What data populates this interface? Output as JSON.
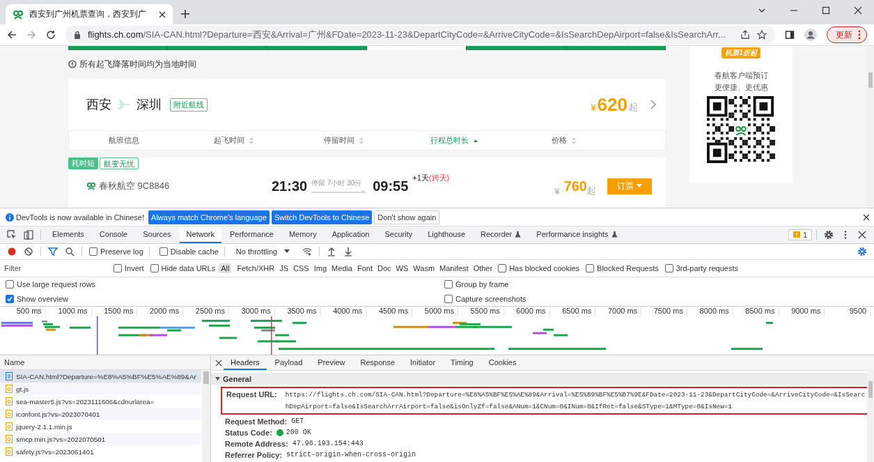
{
  "browser": {
    "tab_title": "西安到广州机票查询，西安到广",
    "url_host": "flights.ch.com",
    "url_path": "/SIA-CAN.html?Departure=西安&Arrival=广州&FDate=2023-11-23&DepartCityCode=&ArriveCityCode=&IsSearchDepAirport=false&IsSearchArr...",
    "update_button": "更新"
  },
  "page": {
    "notice": "所有起飞降落时间均为当地时间",
    "route": {
      "from": "西安",
      "to": "深圳",
      "tag": "附近航线",
      "currency": "¥",
      "price": "620",
      "suffix": "起"
    },
    "sort_columns": [
      {
        "label": "航班信息",
        "sortable": false,
        "selected": false
      },
      {
        "label": "起飞时间",
        "sortable": true,
        "selected": false
      },
      {
        "label": "停留时间",
        "sortable": true,
        "selected": false
      },
      {
        "label": "行程总时长",
        "sortable": true,
        "selected": true
      },
      {
        "label": "价格",
        "sortable": true,
        "selected": false
      }
    ],
    "flight": {
      "tags": [
        {
          "label": "耗时短",
          "kind": "filled"
        },
        {
          "label": "航变无忧",
          "kind": "outline"
        }
      ],
      "airline": "春秋航空 9C8846",
      "depart": "21:30",
      "stop": "停留 7小时 30分",
      "arrive": "09:55",
      "next_day": "+1天",
      "next_day_note": "(跨天)",
      "currency": "¥",
      "price": "760",
      "suffix": "起",
      "book_button": "订票"
    },
    "sidebar": {
      "badge": "机票1折起",
      "promo_lines": [
        "春航客户端预订",
        "更便捷、更优惠"
      ]
    }
  },
  "devtools": {
    "notice": "DevTools is now available in Chinese!",
    "notice_buttons": [
      {
        "label": "Always match Chrome's language",
        "kind": "primary"
      },
      {
        "label": "Switch DevTools to Chinese",
        "kind": "primary"
      },
      {
        "label": "Don't show again",
        "kind": "plain"
      }
    ],
    "tabs": [
      {
        "label": "Elements",
        "selected": false,
        "experimental": false
      },
      {
        "label": "Console",
        "selected": false,
        "experimental": false
      },
      {
        "label": "Sources",
        "selected": false,
        "experimental": false
      },
      {
        "label": "Network",
        "selected": true,
        "experimental": false
      },
      {
        "label": "Performance",
        "selected": false,
        "experimental": false
      },
      {
        "label": "Memory",
        "selected": false,
        "experimental": false
      },
      {
        "label": "Application",
        "selected": false,
        "experimental": false
      },
      {
        "label": "Security",
        "selected": false,
        "experimental": false
      },
      {
        "label": "Lighthouse",
        "selected": false,
        "experimental": false
      },
      {
        "label": "Recorder",
        "selected": false,
        "experimental": true
      },
      {
        "label": "Performance insights",
        "selected": false,
        "experimental": true
      }
    ],
    "issues_count": "1",
    "toolbar": {
      "recording": true,
      "checkboxes": [
        {
          "label": "Preserve log",
          "checked": false
        },
        {
          "label": "Disable cache",
          "checked": false
        }
      ],
      "throttling": "No throttling"
    },
    "filter": {
      "placeholder": "Filter",
      "checkboxes_left": [
        {
          "label": "Invert",
          "checked": false
        },
        {
          "label": "Hide data URLs",
          "checked": false
        }
      ],
      "types": [
        {
          "label": "All",
          "selected": true
        },
        {
          "label": "Fetch/XHR",
          "selected": false
        },
        {
          "label": "JS",
          "selected": false
        },
        {
          "label": "CSS",
          "selected": false
        },
        {
          "label": "Img",
          "selected": false
        },
        {
          "label": "Media",
          "selected": false
        },
        {
          "label": "Font",
          "selected": false
        },
        {
          "label": "Doc",
          "selected": false
        },
        {
          "label": "WS",
          "selected": false
        },
        {
          "label": "Wasm",
          "selected": false
        },
        {
          "label": "Manifest",
          "selected": false
        },
        {
          "label": "Other",
          "selected": false
        }
      ],
      "checkboxes_right": [
        {
          "label": "Has blocked cookies",
          "checked": false
        },
        {
          "label": "Blocked Requests",
          "checked": false
        },
        {
          "label": "3rd-party requests",
          "checked": false
        }
      ]
    },
    "settings": [
      {
        "label": "Use large request rows",
        "checked": false
      },
      {
        "label": "Group by frame",
        "checked": false
      },
      {
        "label": "Show overview",
        "checked": true
      },
      {
        "label": "Capture screenshots",
        "checked": false
      }
    ],
    "timeline_ticks": [
      "500 ms",
      "1000 ms",
      "1500 ms",
      "2000 ms",
      "2500 ms",
      "3000 ms",
      "3500 ms",
      "4000 ms",
      "4500 ms",
      "5000 ms",
      "5500 ms",
      "6000 ms",
      "6500 ms",
      "7000 ms",
      "7500 ms",
      "8000 ms",
      "8500 ms",
      "9000 ms",
      "9500"
    ],
    "requests": {
      "header": "Name",
      "rows": [
        {
          "name": "SIA-CAN.html?Departure=%E8%A5%BF%E5%AE%89&Ar",
          "kind": "document",
          "selected": true
        },
        {
          "name": "gt.js",
          "kind": "script",
          "selected": false
        },
        {
          "name": "sea-master5.js?vs=2023111606&cdnurlarea=",
          "kind": "script",
          "selected": false
        },
        {
          "name": "iconfont.js?vs=2023070401",
          "kind": "script",
          "selected": false
        },
        {
          "name": "jquery-2.1.1.min.js",
          "kind": "script",
          "selected": false
        },
        {
          "name": "smcp.min.js?vs=2022070501",
          "kind": "script",
          "selected": false
        },
        {
          "name": "safety.js?vs=2023061401",
          "kind": "script",
          "selected": false
        }
      ]
    },
    "details": {
      "tabs": [
        {
          "label": "Headers",
          "selected": true
        },
        {
          "label": "Payload",
          "selected": false
        },
        {
          "label": "Preview",
          "selected": false
        },
        {
          "label": "Response",
          "selected": false
        },
        {
          "label": "Initiator",
          "selected": false
        },
        {
          "label": "Timing",
          "selected": false
        },
        {
          "label": "Cookies",
          "selected": false
        }
      ],
      "section": "General",
      "expanded": true,
      "fields": [
        {
          "label": "Request URL:",
          "value": "https://flights.ch.com/SIA-CAN.html?Departure=%E8%A5%BF%E5%AE%89&Arrival=%E5%B9%BF%E5%B7%9E&FDate=2023-11-23&DepartCityCode=&ArriveCityCode=&IsSearchDepAirport=false&IsSearchArrAirport=false&isOnlyZf=false&ANum=1&CNum=0&INum=0&IfRet=false&SType=1&MType=0&IsNew=1",
          "kind": "url",
          "highlighted": true
        },
        {
          "label": "Request Method:",
          "value": "GET",
          "kind": "plain",
          "highlighted": false
        },
        {
          "label": "Status Code:",
          "value": "200 OK",
          "kind": "status",
          "highlighted": false
        },
        {
          "label": "Remote Address:",
          "value": "47.96.193.154:443",
          "kind": "plain",
          "highlighted": false
        },
        {
          "label": "Referrer Policy:",
          "value": "strict-origin-when-cross-origin",
          "kind": "plain",
          "highlighted": false
        }
      ]
    }
  }
}
